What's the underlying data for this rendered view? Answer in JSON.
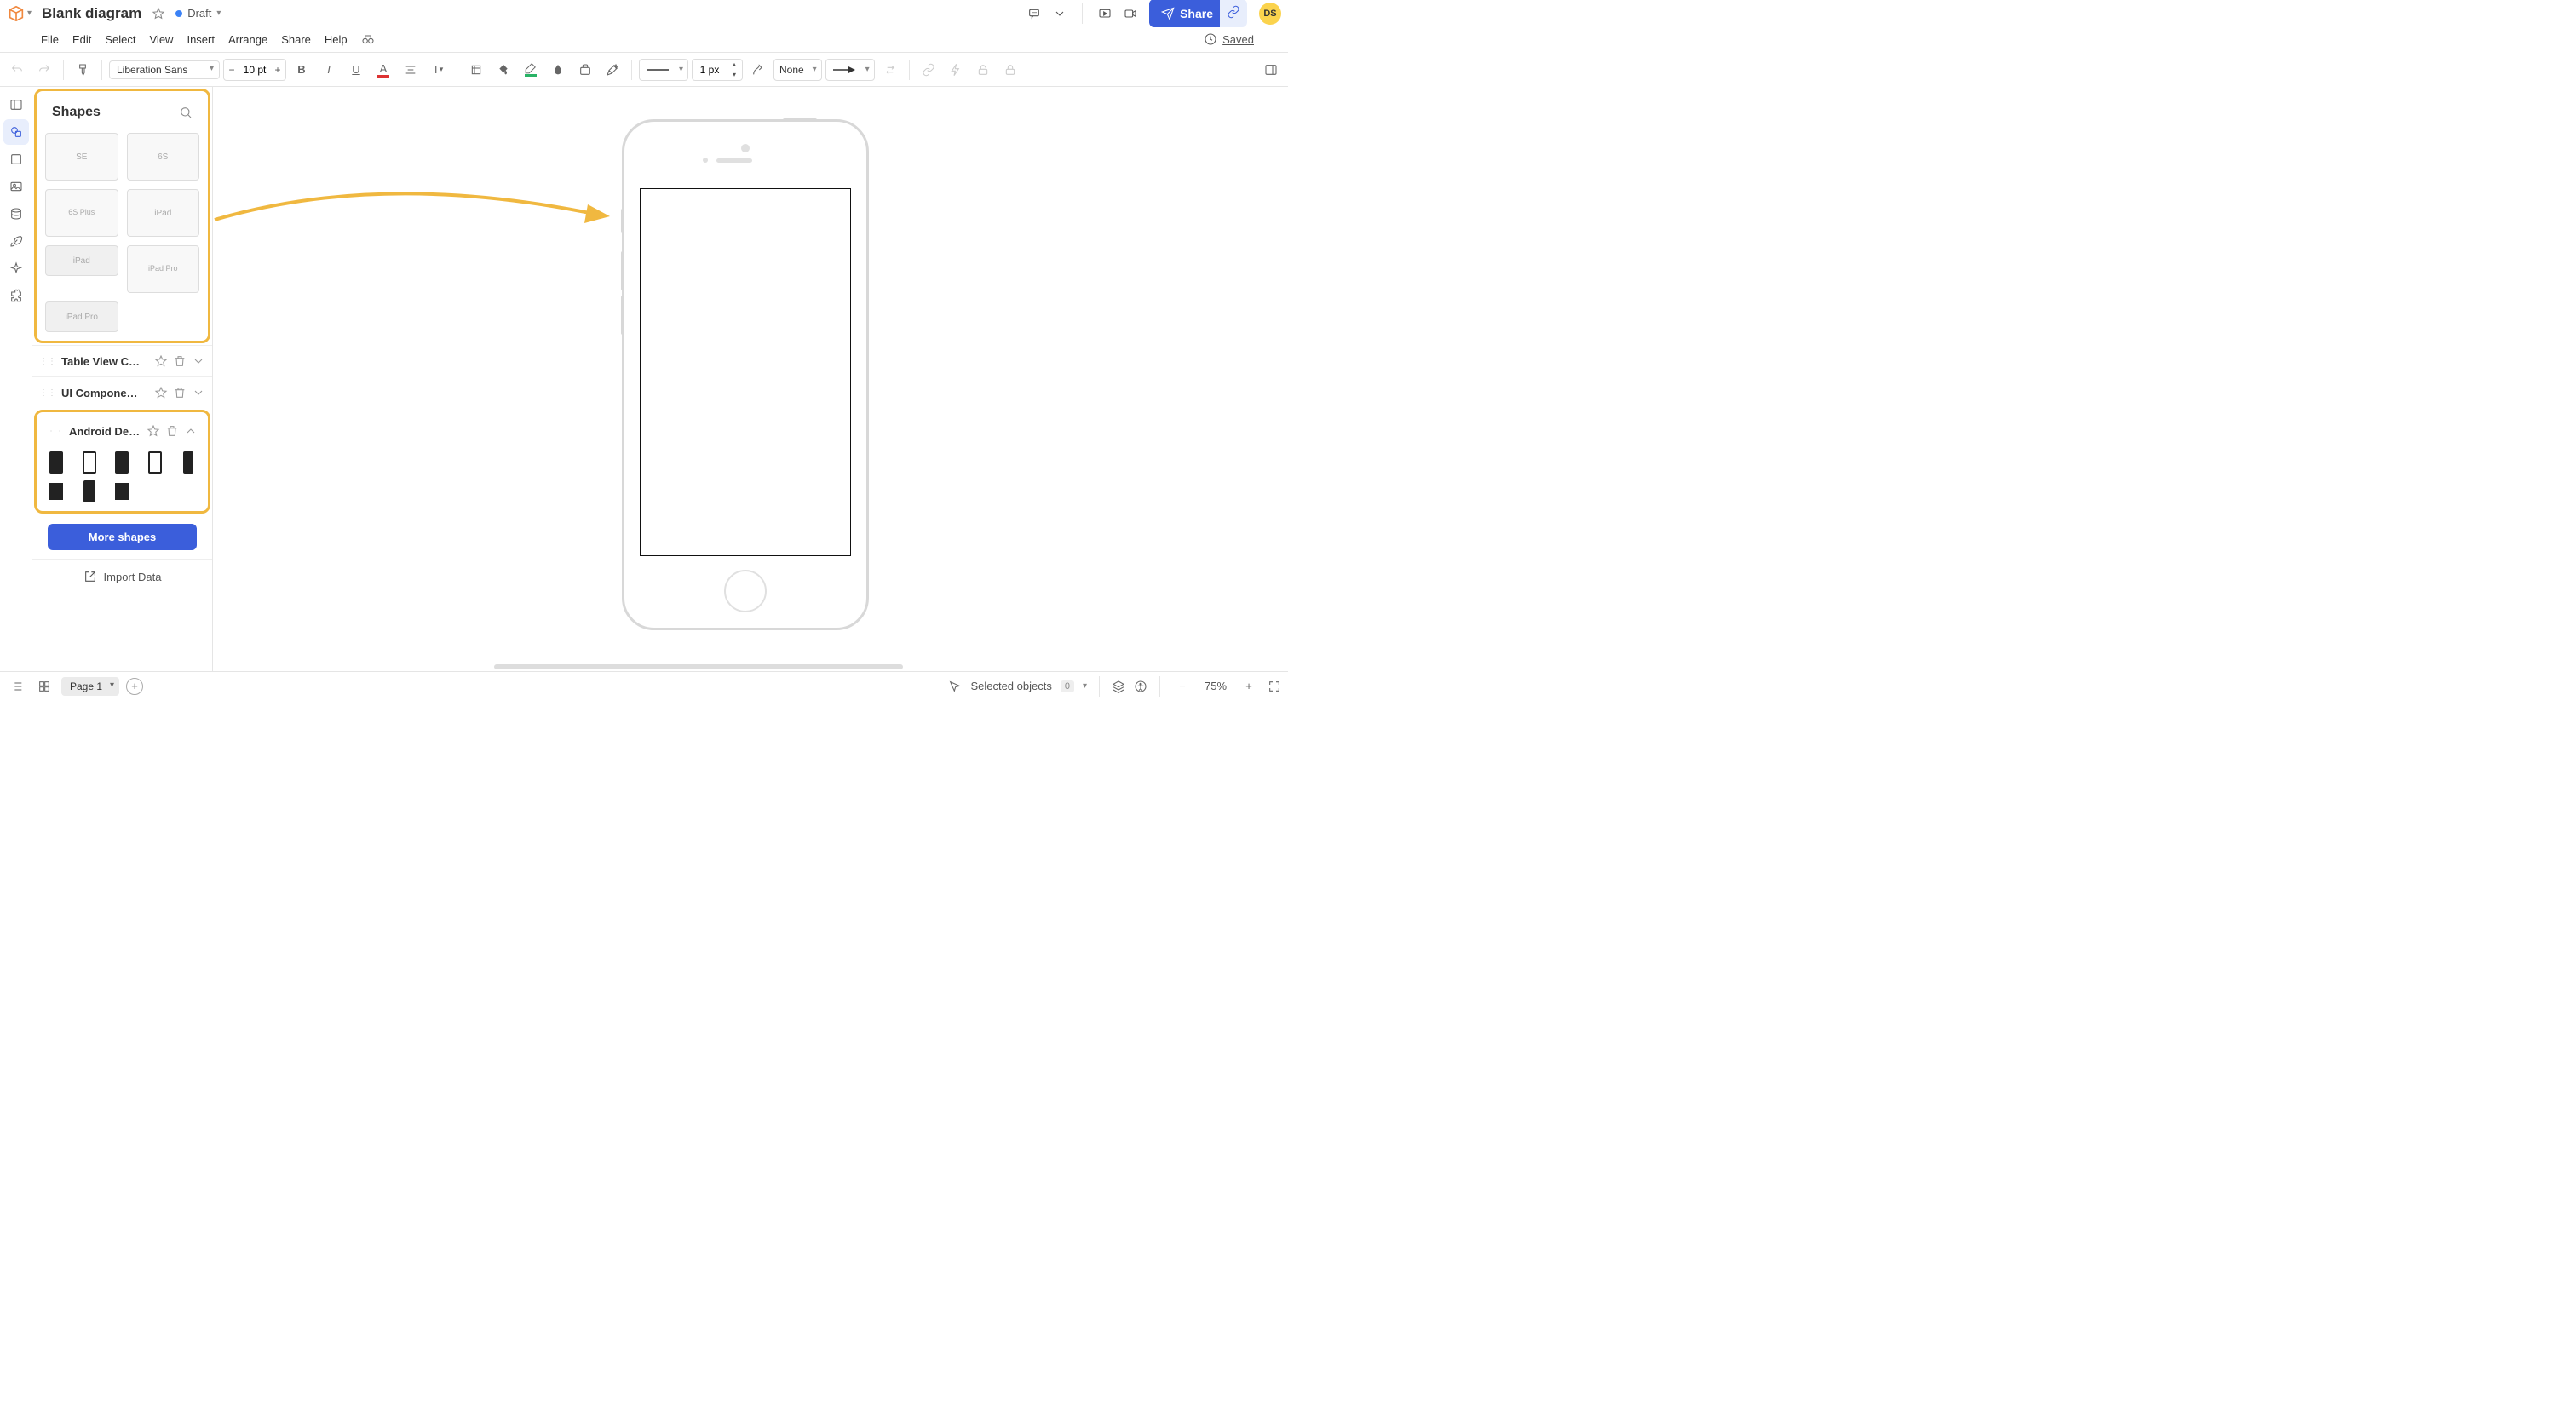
{
  "doc": {
    "title": "Blank diagram",
    "status_label": "Draft",
    "saved_label": "Saved"
  },
  "menus": [
    "File",
    "Edit",
    "Select",
    "View",
    "Insert",
    "Arrange",
    "Share",
    "Help"
  ],
  "header": {
    "share_label": "Share",
    "avatar_initials": "DS"
  },
  "toolbar": {
    "font_family": "Liberation Sans",
    "font_size": "10 pt",
    "line_width": "1 px",
    "line_end": "None"
  },
  "sidebar": {
    "title": "Shapes",
    "ios_devices": [
      "SE",
      "6S",
      "6S Plus",
      "iPad",
      "iPad",
      "iPad Pro",
      "iPad Pro"
    ],
    "sections": {
      "table_view": "Table View C…",
      "ui_components": "UI Compone…",
      "android": "Android Devi…"
    },
    "more_shapes": "More shapes",
    "import_data": "Import Data"
  },
  "bottom": {
    "page_label": "Page 1",
    "selected_label": "Selected objects",
    "selected_count": "0",
    "zoom": "75%"
  }
}
